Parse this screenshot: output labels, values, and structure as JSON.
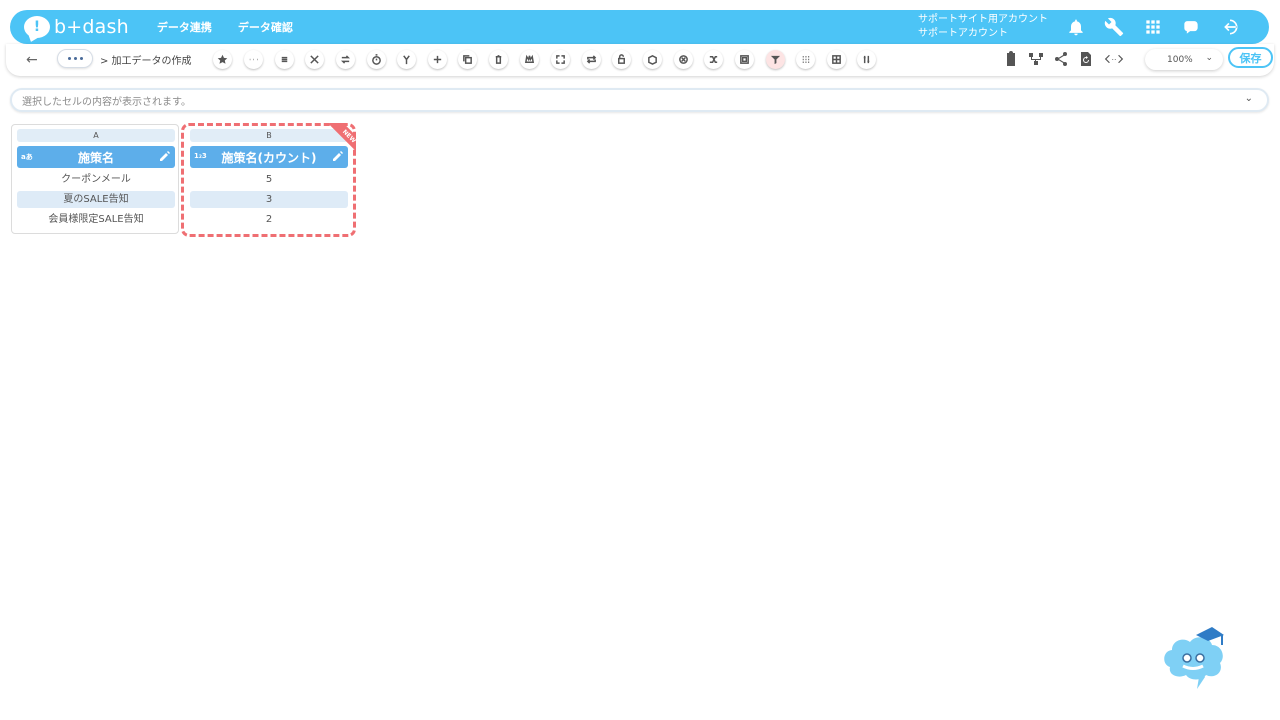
{
  "header": {
    "logo_text": "b+dash",
    "nav": [
      "データ連携",
      "データ確認"
    ],
    "account_line1": "サポートサイト用アカウント",
    "account_line2": "サポートアカウント",
    "icons": [
      "bell-icon",
      "wrench-icon",
      "apps-grid-icon",
      "support-chat-icon",
      "logout-icon"
    ]
  },
  "toolbar": {
    "breadcrumb": "> 加工データの作成",
    "tools": [
      "star-icon",
      "more-icon",
      "list-icon",
      "cut-icon",
      "swap-icon",
      "timer-icon",
      "branch-icon",
      "plus-icon",
      "copy-icon",
      "trash-icon",
      "crown-icon",
      "expand-icon",
      "repeat-icon",
      "lock-icon",
      "box-icon",
      "close-circle-icon",
      "shuffle-icon",
      "frame-icon",
      "filter-icon",
      "grid-dots-icon",
      "table-icon",
      "columns-icon"
    ],
    "right_tools": [
      "clipboard-icon",
      "hierarchy-icon",
      "share-icon",
      "refresh-doc-icon",
      "code-icon"
    ],
    "zoom": "100%",
    "save_label": "保存"
  },
  "formula": {
    "placeholder": "選択したセルの内容が表示されます。"
  },
  "table": {
    "columns": [
      {
        "letter": "A",
        "type": "aあ",
        "name": "施策名",
        "cells": [
          "クーポンメール",
          "夏のSALE告知",
          "会員様限定SALE告知"
        ]
      },
      {
        "letter": "B",
        "type": "1₂3",
        "name": "施策名(カウント)",
        "cells": [
          "5",
          "3",
          "2"
        ],
        "badge": "NEW"
      }
    ]
  },
  "colors": {
    "accent": "#4cc4f6",
    "header_col": "#5daeea",
    "highlight": "#ef6f73"
  }
}
